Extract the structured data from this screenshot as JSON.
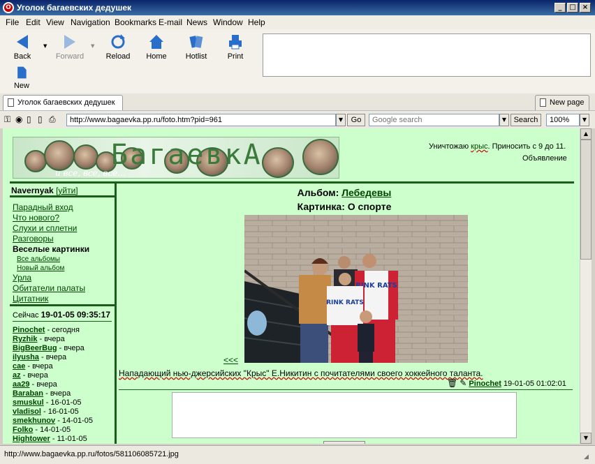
{
  "window": {
    "title": "Уголок багаевских дедушек"
  },
  "menubar": [
    "File",
    "Edit",
    "View",
    "Navigation",
    "Bookmarks",
    "E-mail",
    "News",
    "Window",
    "Help"
  ],
  "toolbar": {
    "back": "Back",
    "forward": "Forward",
    "reload": "Reload",
    "home": "Home",
    "hotlist": "Hotlist",
    "print": "Print",
    "new": "New"
  },
  "tabs": {
    "active": "Уголок багаевских дедушек",
    "new_page": "New page"
  },
  "nav": {
    "url": "http://www.bagaevka.pp.ru/foto.htm?pid=961",
    "go": "Go",
    "search_placeholder": "Google search",
    "search_btn": "Search",
    "zoom": "100%"
  },
  "banner": {
    "logo": "БагаевкА",
    "tagline": "и все, все, все..."
  },
  "ad": {
    "text_a": "Уничтожаю",
    "text_link": "крыс",
    "text_b": ". Приносить с 9 до 11.",
    "label": "Объявление"
  },
  "user": {
    "name": "Navernyak",
    "logout": "[уйти]"
  },
  "menu": [
    {
      "label": "Парадный вход",
      "type": "link"
    },
    {
      "label": "Что нового?",
      "type": "link"
    },
    {
      "label": "Слухи и сплетни",
      "type": "link"
    },
    {
      "label": "Разговоры",
      "type": "link"
    },
    {
      "label": "Веселые картинки",
      "type": "bold"
    },
    {
      "label": "Все альбомы",
      "type": "sub"
    },
    {
      "label": "Новый альбом",
      "type": "sub"
    },
    {
      "label": "Урла",
      "type": "link"
    },
    {
      "label": "Обитатели палаты",
      "type": "link"
    },
    {
      "label": "Цитатник",
      "type": "link"
    }
  ],
  "now": {
    "label": "Сейчас",
    "time": "19-01-05 09:35:17"
  },
  "users": [
    {
      "name": "Pinochet",
      "when": "- сегодня"
    },
    {
      "name": "Ryzhik",
      "when": "- вчера"
    },
    {
      "name": "BigBeerBug",
      "when": "- вчера"
    },
    {
      "name": "ilyusha",
      "when": "- вчера"
    },
    {
      "name": "cae",
      "when": "- вчера"
    },
    {
      "name": "az",
      "when": "- вчера"
    },
    {
      "name": "aa29",
      "when": "- вчера"
    },
    {
      "name": "Baraban",
      "when": "- вчера"
    },
    {
      "name": "smuskul",
      "when": "- 16-01-05"
    },
    {
      "name": "vladisol",
      "when": "- 16-01-05"
    },
    {
      "name": "smekhunov",
      "when": "- 14-01-05"
    },
    {
      "name": "Folko",
      "when": "- 14-01-05"
    },
    {
      "name": "Hightower",
      "when": "- 11-01-05"
    }
  ],
  "album": {
    "label": "Альбом",
    "name": "Лебедевы"
  },
  "picture": {
    "label": "Картинка",
    "name": "О спорте"
  },
  "photo": {
    "jersey": "RINK RATS"
  },
  "nav_prev": "<<<",
  "caption": "Нападающий нью-джерсийских \"Крыс\" Е.Никитин с почитателями своего хоккейного таланта.",
  "post": {
    "author": "Pinochet",
    "date": "19-01-05 01:02:01"
  },
  "statusbar": {
    "url": "http://www.bagaevka.pp.ru/fotos/581106085721.jpg"
  },
  "colors": {
    "page_bg": "#ccffcc",
    "separator": "#1a5c1a",
    "link": "#004400"
  }
}
